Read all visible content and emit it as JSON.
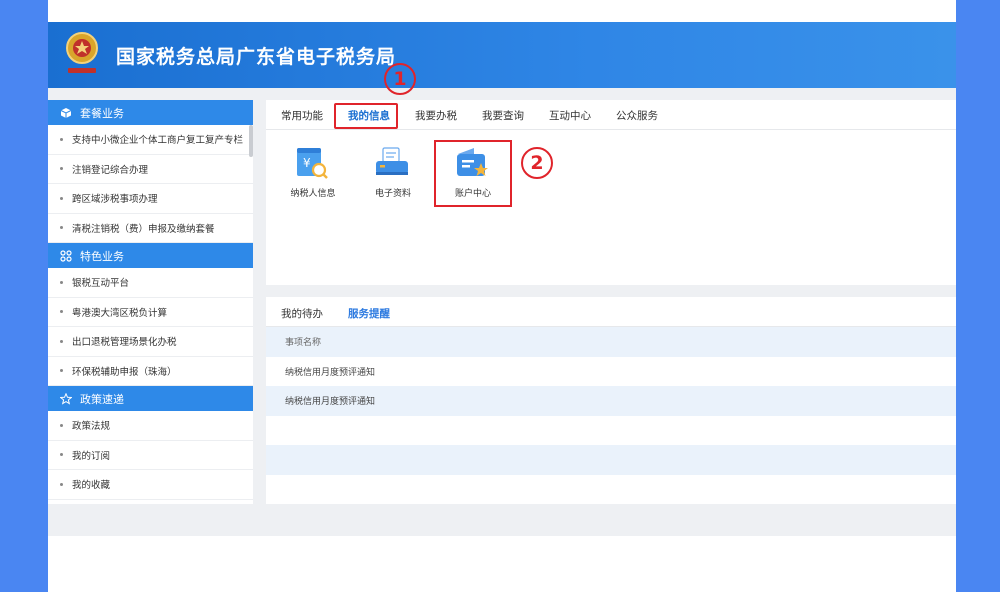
{
  "header": {
    "title": "国家税务总局广东省电子税务局"
  },
  "sidebar": {
    "sections": [
      {
        "title": "套餐业务",
        "icon": "package-icon",
        "items": [
          "支持中小微企业个体工商户复工复产专栏",
          "注销登记综合办理",
          "跨区域涉税事项办理",
          "清税注销税（费）申报及缴纳套餐"
        ]
      },
      {
        "title": "特色业务",
        "icon": "grid-icon",
        "items": [
          "银税互动平台",
          "粤港澳大湾区税负计算",
          "出口退税管理场景化办税",
          "环保税辅助申报（珠海）"
        ]
      },
      {
        "title": "政策速递",
        "icon": "star-icon",
        "items": [
          "政策法规",
          "我的订阅",
          "我的收藏"
        ]
      }
    ]
  },
  "tabs": [
    "常用功能",
    "我的信息",
    "我要办税",
    "我要查询",
    "互动中心",
    "公众服务"
  ],
  "active_tab": "我的信息",
  "apps": [
    {
      "label": "纳税人信息",
      "icon": "taxpayer-info-icon"
    },
    {
      "label": "电子资料",
      "icon": "electronic-data-icon"
    },
    {
      "label": "账户中心",
      "icon": "account-center-icon"
    }
  ],
  "annotations": {
    "step1": "1",
    "step2": "2"
  },
  "bottom": {
    "tabs": [
      "我的待办",
      "服务提醒"
    ],
    "active_tab": "服务提醒",
    "table_header": "事项名称",
    "rows": [
      "纳税信用月度预评通知",
      "纳税信用月度预评通知"
    ]
  },
  "colors": {
    "accent": "#2e89e8",
    "highlight": "#e0242b",
    "page_bg": "#4a86f2"
  }
}
